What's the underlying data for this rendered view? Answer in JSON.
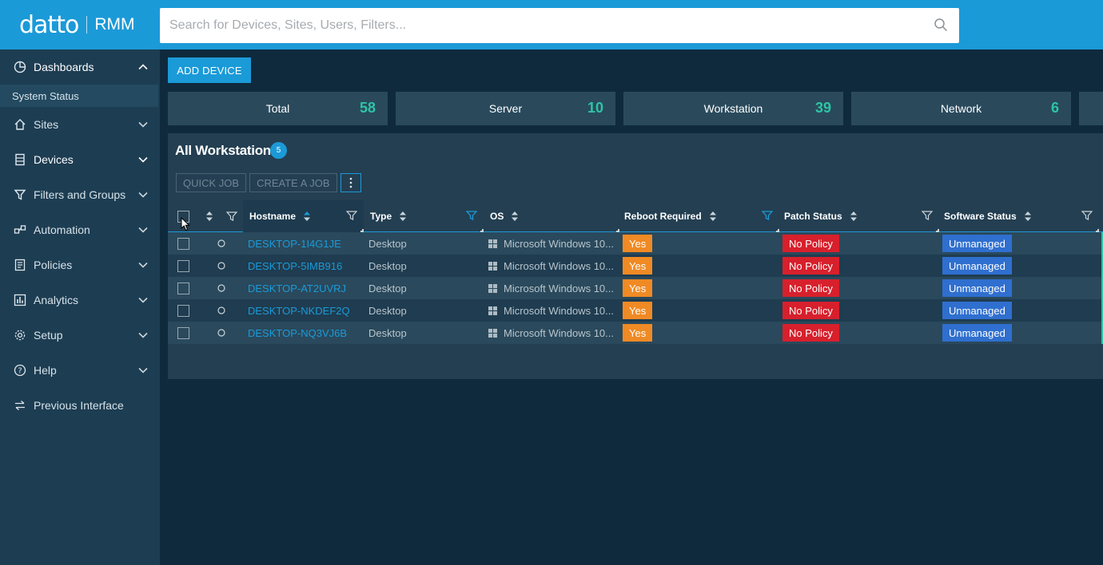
{
  "app": {
    "brand": "datto",
    "product": "RMM"
  },
  "search": {
    "placeholder": "Search for Devices, Sites, Users, Filters..."
  },
  "sidebar": {
    "items": [
      {
        "label": "Dashboards",
        "icon": "pie-chart-icon",
        "expanded": true
      },
      {
        "label": "Sites",
        "icon": "home-icon"
      },
      {
        "label": "Devices",
        "icon": "server-icon"
      },
      {
        "label": "Filters and Groups",
        "icon": "filter-icon"
      },
      {
        "label": "Automation",
        "icon": "automation-icon"
      },
      {
        "label": "Policies",
        "icon": "policies-icon"
      },
      {
        "label": "Analytics",
        "icon": "analytics-icon"
      },
      {
        "label": "Setup",
        "icon": "gear-icon"
      },
      {
        "label": "Help",
        "icon": "help-icon"
      },
      {
        "label": "Previous Interface",
        "icon": "switch-icon"
      }
    ],
    "subitem": "System Status"
  },
  "main": {
    "add_device": "ADD DEVICE",
    "stats": [
      {
        "label": "Total",
        "value": "58"
      },
      {
        "label": "Server",
        "value": "10"
      },
      {
        "label": "Workstation",
        "value": "39"
      },
      {
        "label": "Network",
        "value": "6"
      }
    ],
    "panel": {
      "title": "All Workstations",
      "count": "5",
      "quick_job": "QUICK JOB",
      "create_job": "CREATE A JOB"
    },
    "table": {
      "headers": {
        "hostname": "Hostname",
        "type": "Type",
        "os": "OS",
        "reboot": "Reboot Required",
        "patch": "Patch Status",
        "software": "Software Status"
      },
      "rows": [
        {
          "hostname": "DESKTOP-1I4G1JE",
          "type": "Desktop",
          "os": "Microsoft Windows 10...",
          "reboot": "Yes",
          "patch": "No Policy",
          "software": "Unmanaged"
        },
        {
          "hostname": "DESKTOP-5IMB916",
          "type": "Desktop",
          "os": "Microsoft Windows 10...",
          "reboot": "Yes",
          "patch": "No Policy",
          "software": "Unmanaged"
        },
        {
          "hostname": "DESKTOP-AT2UVRJ",
          "type": "Desktop",
          "os": "Microsoft Windows 10...",
          "reboot": "Yes",
          "patch": "No Policy",
          "software": "Unmanaged"
        },
        {
          "hostname": "DESKTOP-NKDEF2Q",
          "type": "Desktop",
          "os": "Microsoft Windows 10...",
          "reboot": "Yes",
          "patch": "No Policy",
          "software": "Unmanaged"
        },
        {
          "hostname": "DESKTOP-NQ3VJ6B",
          "type": "Desktop",
          "os": "Microsoft Windows 10...",
          "reboot": "Yes",
          "patch": "No Policy",
          "software": "Unmanaged"
        }
      ]
    }
  },
  "colors": {
    "topbar": "#1b9ad8",
    "stat_value": "#2ec4a5",
    "reboot_yes": "#f08a24",
    "patch_no_policy": "#d7202c",
    "software_unmanaged": "#2f6fcf"
  }
}
